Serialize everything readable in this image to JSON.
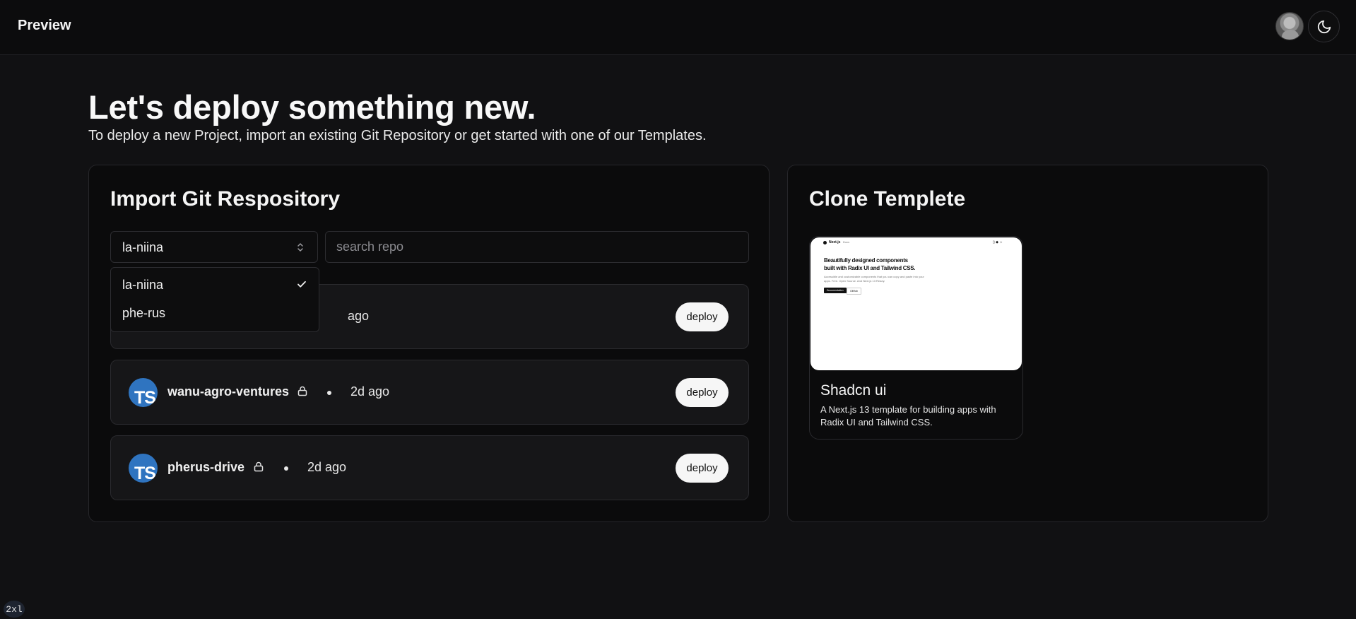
{
  "header": {
    "title": "Preview",
    "avatar_label": "user-avatar",
    "theme_icon": "moon-icon"
  },
  "hero": {
    "title": "Let's deploy something new.",
    "subtitle": "To deploy a new Project, import an existing Git Repository or get started with one of our Templates."
  },
  "import": {
    "title": "Import Git Respository",
    "account_select": {
      "value": "la-niina",
      "options": [
        {
          "label": "la-niina",
          "selected": true
        },
        {
          "label": "phe-rus",
          "selected": false
        }
      ]
    },
    "search": {
      "placeholder": "search repo",
      "value": ""
    },
    "repos": [
      {
        "name": "",
        "private": true,
        "time": "ago",
        "deploy_label": "deploy"
      },
      {
        "name": "wanu-agro-ventures",
        "private": true,
        "time": "2d ago",
        "deploy_label": "deploy"
      },
      {
        "name": "pherus-drive",
        "private": true,
        "time": "2d ago",
        "deploy_label": "deploy"
      }
    ],
    "repo_icon_text": "TS"
  },
  "clone": {
    "title": "Clone Templete",
    "templates": [
      {
        "name": "Shadcn ui",
        "description": "A Next.js 13 template for building apps with Radix UI and Tailwind CSS.",
        "preview": {
          "brand": "Next.js",
          "nav": "Docs",
          "headline_1": "Beautifully designed components",
          "headline_2": "built with Radix UI and Tailwind CSS.",
          "body_1": "Accessible and customizable components that you can copy and paste into your",
          "body_2": "apps. Free. Open Source. And Next.js 13 Ready.",
          "primary_btn": "Documentation",
          "secondary_btn": "GitHub"
        }
      }
    ]
  },
  "breakpoint": "2xl"
}
